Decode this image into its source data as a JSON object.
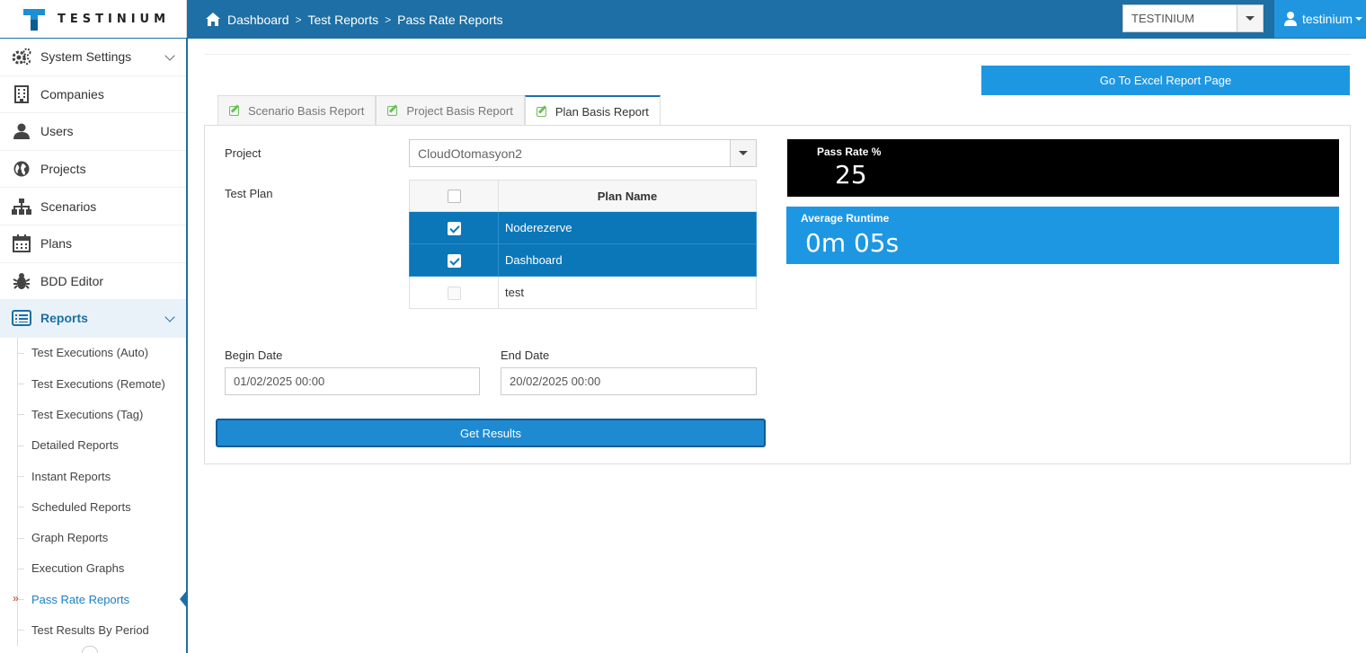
{
  "app": {
    "logo_text": "TESTINIUM",
    "accent_color": "#1d6fa5",
    "primary_button_color": "#1e97e3"
  },
  "breadcrumb": [
    "Dashboard",
    "Test Reports",
    "Pass Rate Reports"
  ],
  "header": {
    "tenant_select_value": "TESTINIUM",
    "user_name": "testinium"
  },
  "sidebar": {
    "items": [
      {
        "label": "System Settings",
        "icon": "gears-icon",
        "expandable": true
      },
      {
        "label": "Companies",
        "icon": "building-icon"
      },
      {
        "label": "Users",
        "icon": "user-icon"
      },
      {
        "label": "Projects",
        "icon": "globe-icon"
      },
      {
        "label": "Scenarios",
        "icon": "sitemap-icon"
      },
      {
        "label": "Plans",
        "icon": "calendar-icon"
      },
      {
        "label": "BDD Editor",
        "icon": "bug-icon"
      },
      {
        "label": "Reports",
        "icon": "list-icon",
        "expandable": true,
        "active": true
      }
    ],
    "report_subitems": [
      "Test Executions (Auto)",
      "Test Executions (Remote)",
      "Test Executions (Tag)",
      "Detailed Reports",
      "Instant Reports",
      "Scheduled Reports",
      "Graph Reports",
      "Execution Graphs",
      "Pass Rate Reports",
      "Test Results By Period"
    ],
    "active_subitem": "Pass Rate Reports"
  },
  "main": {
    "excel_button_label": "Go To Excel Report Page",
    "tabs": [
      {
        "label": "Scenario Basis Report",
        "active": false
      },
      {
        "label": "Project Basis Report",
        "active": false
      },
      {
        "label": "Plan Basis Report",
        "active": true
      }
    ],
    "form": {
      "project_label": "Project",
      "project_value": "CloudOtomasyon2",
      "test_plan_label": "Test Plan",
      "plan_table_header": "Plan Name",
      "plans": [
        {
          "name": "Noderezerve",
          "checked": true
        },
        {
          "name": "Dashboard",
          "checked": true
        },
        {
          "name": "test",
          "checked": false
        }
      ],
      "begin_date_label": "Begin Date",
      "begin_date_value": "01/02/2025 00:00",
      "end_date_label": "End Date",
      "end_date_value": "20/02/2025 00:00",
      "get_results_label": "Get Results"
    },
    "stats": {
      "pass_rate_title": "Pass Rate %",
      "pass_rate_value": "25",
      "runtime_title": "Average Runtime",
      "runtime_value": "0m 05s"
    }
  }
}
